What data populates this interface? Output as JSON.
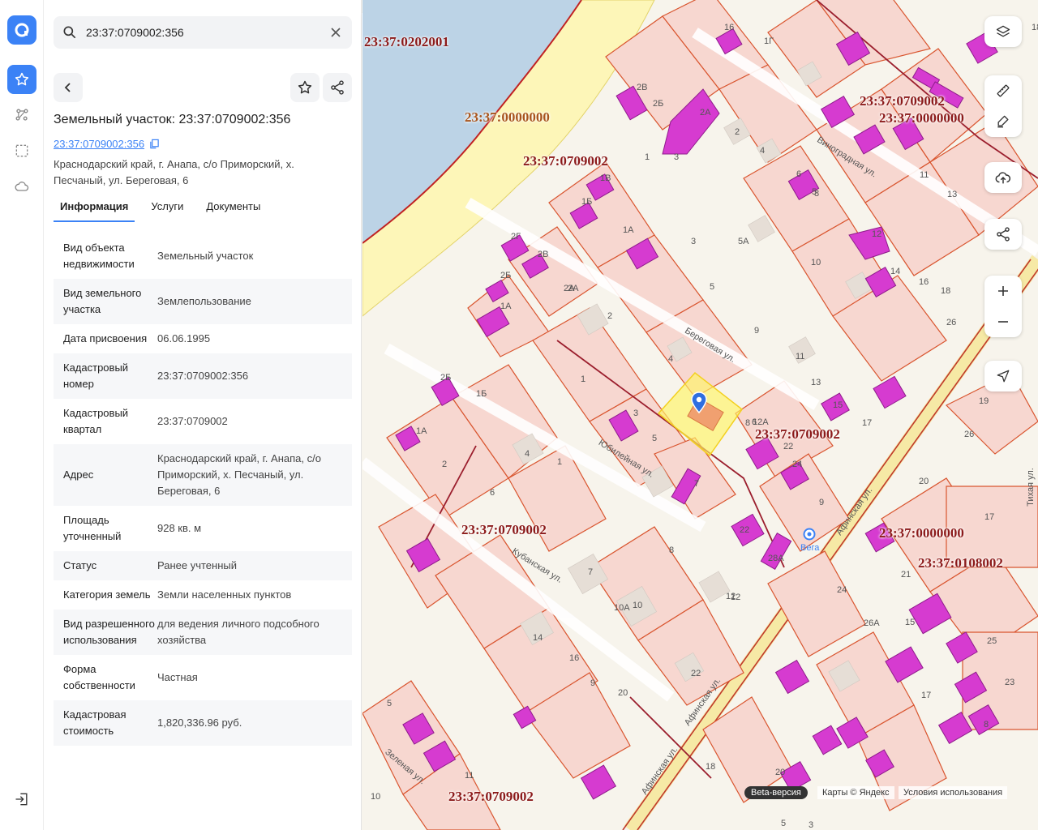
{
  "search": {
    "value": "23:37:0709002:356"
  },
  "object": {
    "title": "Земельный участок: 23:37:0709002:356",
    "cad_link": "23:37:0709002:356",
    "address": "Краснодарский край, г. Анапа, с/о Приморский, х. Песчаный, ул. Береговая, 6"
  },
  "tabs": [
    {
      "label": "Информация",
      "active": true
    },
    {
      "label": "Услуги",
      "active": false
    },
    {
      "label": "Документы",
      "active": false
    }
  ],
  "info": [
    {
      "k": "Вид объекта недвижимости",
      "v": "Земельный участок"
    },
    {
      "k": "Вид земельного участка",
      "v": "Землепользование"
    },
    {
      "k": "Дата присвоения",
      "v": "06.06.1995"
    },
    {
      "k": "Кадастровый номер",
      "v": "23:37:0709002:356"
    },
    {
      "k": "Кадастровый квартал",
      "v": "23:37:0709002"
    },
    {
      "k": "Адрес",
      "v": "Краснодарский край, г. Анапа, с/о Приморский, х. Песчаный, ул. Береговая, 6"
    },
    {
      "k": "Площадь уточненный",
      "v": "928 кв. м"
    },
    {
      "k": "Статус",
      "v": "Ранее учтенный"
    },
    {
      "k": "Категория земель",
      "v": "Земли населенных пунктов"
    },
    {
      "k": "Вид разрешенного использования",
      "v": "для ведения личного подсобного хозяйства"
    },
    {
      "k": "Форма собственности",
      "v": "Частная"
    },
    {
      "k": "Кадастровая стоимость",
      "v": "1,820,336.96 руб."
    }
  ],
  "map": {
    "quarter_labels": [
      {
        "text": "23:37:0202001",
        "orange": false
      },
      {
        "text": "23:37:0000000",
        "orange": true
      },
      {
        "text": "23:37:0709002",
        "orange": false
      },
      {
        "text": "23:37:0709002",
        "orange": false
      },
      {
        "text": "23:37:0000000",
        "orange": false
      },
      {
        "text": "23:37:0709002",
        "orange": false
      },
      {
        "text": "23:37:0709002",
        "orange": false
      },
      {
        "text": "23:37:0000000",
        "orange": false
      },
      {
        "text": "23:37:0108002",
        "orange": false
      },
      {
        "text": "23:37:0709002",
        "orange": false
      }
    ],
    "streets": [
      "Виноградная ул.",
      "Береговая ул.",
      "Юбилейная ул.",
      "Кубанская ул.",
      "Афинская ул.",
      "Афинская ул.",
      "Афинская ул.",
      "Зеленая ул.",
      "Тихая ул."
    ],
    "numbers": [
      "16",
      "1Г",
      "2В",
      "2Б",
      "2А",
      "2",
      "4",
      "1",
      "3",
      "1В",
      "1Б",
      "1А",
      "3",
      "5А",
      "5",
      "2Г",
      "2В",
      "2Б",
      "2А",
      "1А",
      "2",
      "4",
      "1",
      "3",
      "8",
      "6",
      "5",
      "10",
      "12",
      "14",
      "16",
      "18",
      "11",
      "13",
      "15",
      "17",
      "9",
      "6",
      "8",
      "11",
      "13",
      "18",
      "2А",
      "2Б",
      "1Б",
      "1А",
      "2",
      "4",
      "1",
      "6",
      "5",
      "7",
      "8",
      "12",
      "10",
      "12",
      "14",
      "16",
      "9",
      "20",
      "22",
      "19",
      "26",
      "20",
      "17",
      "21",
      "15",
      "17",
      "24",
      "26А",
      "25",
      "23",
      "8",
      "12А",
      "22",
      "18",
      "20",
      "11",
      "10",
      "5",
      "7",
      "10А",
      "24",
      "9",
      "22",
      "28А",
      "26",
      "1",
      "3",
      "5"
    ],
    "poi": "Вега",
    "beta_label": "Beta-версия",
    "copyright": "Карты © Яндекс",
    "terms": "Условия использования"
  },
  "colors": {
    "accent": "#3b82f6",
    "parcel_fill": "#f7d7d0",
    "parcel_stroke": "#d9552f",
    "building": "#d63bd0",
    "quarter_line": "#9b1e2d",
    "sea": "#bcd3e6",
    "beach": "#fdf6b8"
  }
}
